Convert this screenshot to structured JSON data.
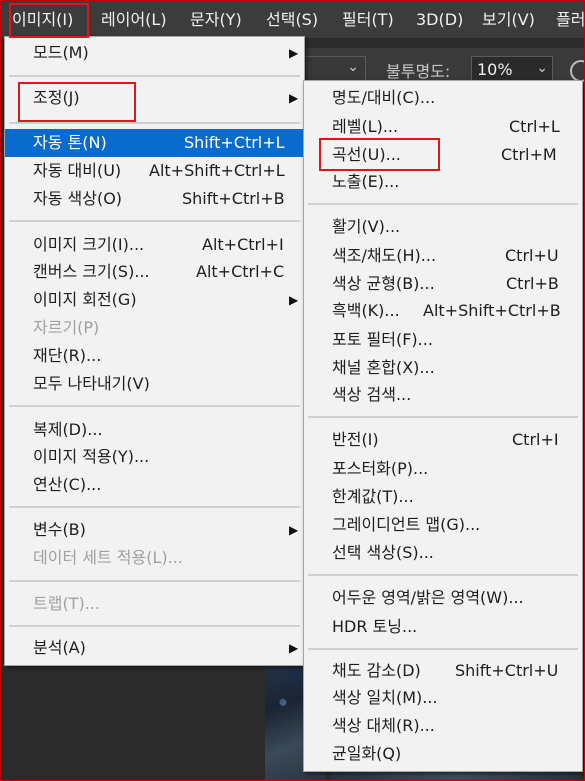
{
  "menubar": {
    "items": [
      {
        "label": "이미지(I)"
      },
      {
        "label": "레이어(L)"
      },
      {
        "label": "문자(Y)"
      },
      {
        "label": "선택(S)"
      },
      {
        "label": "필터(T)"
      },
      {
        "label": "3D(D)"
      },
      {
        "label": "보기(V)"
      },
      {
        "label": "플러"
      }
    ]
  },
  "options_bar": {
    "opacity_label": "불투명도:",
    "opacity_value": "10%",
    "dropdown_chevron": "⌄"
  },
  "image_menu": {
    "items": [
      {
        "label": "모드(M)",
        "shortcut": "",
        "submenu": true
      },
      {
        "label": "조정(J)",
        "shortcut": "",
        "submenu": true
      },
      {
        "label": "자동 톤(N)",
        "shortcut": "Shift+Ctrl+L",
        "highlighted": true
      },
      {
        "label": "자동 대비(U)",
        "shortcut": "Alt+Shift+Ctrl+L"
      },
      {
        "label": "자동 색상(O)",
        "shortcut": "Shift+Ctrl+B"
      },
      {
        "label": "이미지 크기(I)...",
        "shortcut": "Alt+Ctrl+I"
      },
      {
        "label": "캔버스 크기(S)...",
        "shortcut": "Alt+Ctrl+C"
      },
      {
        "label": "이미지 회전(G)",
        "shortcut": "",
        "submenu": true
      },
      {
        "label": "자르기(P)",
        "shortcut": "",
        "disabled": true
      },
      {
        "label": "재단(R)...",
        "shortcut": ""
      },
      {
        "label": "모두 나타내기(V)",
        "shortcut": ""
      },
      {
        "label": "복제(D)...",
        "shortcut": ""
      },
      {
        "label": "이미지 적용(Y)...",
        "shortcut": ""
      },
      {
        "label": "연산(C)...",
        "shortcut": ""
      },
      {
        "label": "변수(B)",
        "shortcut": "",
        "submenu": true
      },
      {
        "label": "데이터 세트 적용(L)...",
        "shortcut": "",
        "disabled": true
      },
      {
        "label": "트랩(T)...",
        "shortcut": "",
        "disabled": true
      },
      {
        "label": "분석(A)",
        "shortcut": "",
        "submenu": true
      }
    ]
  },
  "adjust_submenu": {
    "items": [
      {
        "label": "명도/대비(C)...",
        "shortcut": ""
      },
      {
        "label": "레벨(L)...",
        "shortcut": "Ctrl+L"
      },
      {
        "label": "곡선(U)...",
        "shortcut": "Ctrl+M"
      },
      {
        "label": "노출(E)...",
        "shortcut": ""
      },
      {
        "label": "활기(V)...",
        "shortcut": ""
      },
      {
        "label": "색조/채도(H)...",
        "shortcut": "Ctrl+U"
      },
      {
        "label": "색상 균형(B)...",
        "shortcut": "Ctrl+B"
      },
      {
        "label": "흑백(K)...",
        "shortcut": "Alt+Shift+Ctrl+B"
      },
      {
        "label": "포토 필터(F)...",
        "shortcut": ""
      },
      {
        "label": "채널 혼합(X)...",
        "shortcut": ""
      },
      {
        "label": "색상 검색...",
        "shortcut": ""
      },
      {
        "label": "반전(I)",
        "shortcut": "Ctrl+I"
      },
      {
        "label": "포스터화(P)...",
        "shortcut": ""
      },
      {
        "label": "한계값(T)...",
        "shortcut": ""
      },
      {
        "label": "그레이디언트 맵(G)...",
        "shortcut": ""
      },
      {
        "label": "선택 색상(S)...",
        "shortcut": ""
      },
      {
        "label": "어두운 영역/밝은 영역(W)...",
        "shortcut": ""
      },
      {
        "label": "HDR 토닝...",
        "shortcut": ""
      },
      {
        "label": "채도 감소(D)",
        "shortcut": "Shift+Ctrl+U"
      },
      {
        "label": "색상 일치(M)...",
        "shortcut": ""
      },
      {
        "label": "색상 대체(R)...",
        "shortcut": ""
      },
      {
        "label": "균일화(Q)",
        "shortcut": ""
      }
    ]
  },
  "submenu_arrow": "▶",
  "annotation_color": "#e3141b",
  "highlight_color": "#0a6bcf"
}
